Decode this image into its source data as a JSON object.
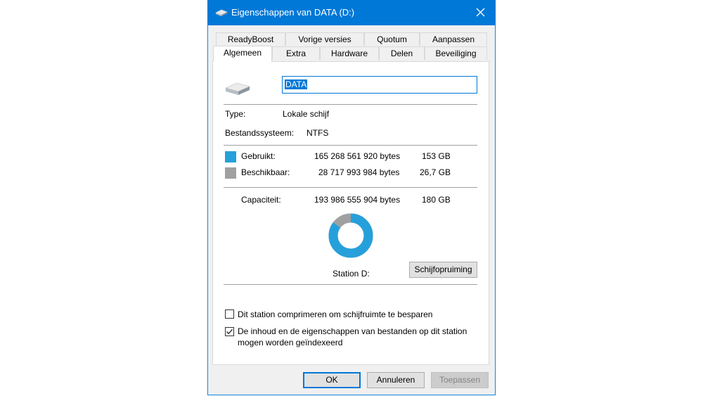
{
  "window": {
    "title": "Eigenschappen van DATA (D:)",
    "close_glyph": "✕"
  },
  "tabs": {
    "row1": [
      "ReadyBoost",
      "Vorige versies",
      "Quotum",
      "Aanpassen"
    ],
    "row2": [
      "Algemeen",
      "Extra",
      "Hardware",
      "Delen",
      "Beveiliging"
    ],
    "active": "Algemeen"
  },
  "general": {
    "drive_icon": "drive-icon",
    "volume_name": "DATA",
    "type_label": "Type:",
    "type_value": "Lokale schijf",
    "fs_label": "Bestandssysteem:",
    "fs_value": "NTFS",
    "used": {
      "label": "Gebruikt:",
      "bytes": "165 268 561 920 bytes",
      "size": "153 GB",
      "color": "#26a0da"
    },
    "free": {
      "label": "Beschikbaar:",
      "bytes": "28 717 993 984 bytes",
      "size": "26,7 GB",
      "color": "#a0a0a0"
    },
    "capacity": {
      "label": "Capaciteit:",
      "bytes": "193 986 555 904 bytes",
      "size": "180 GB"
    },
    "used_fraction": 0.852,
    "station_label": "Station D:",
    "cleanup_button": "Schijfopruiming",
    "compress_label": "Dit station comprimeren om schijfruimte te besparen",
    "compress_checked": false,
    "index_label_line1": "De inhoud en de eigenschappen van bestanden op dit station",
    "index_label_line2": "mogen worden geïndexeerd",
    "index_checked": true
  },
  "buttons": {
    "ok": "OK",
    "cancel": "Annuleren",
    "apply": "Toepassen"
  }
}
